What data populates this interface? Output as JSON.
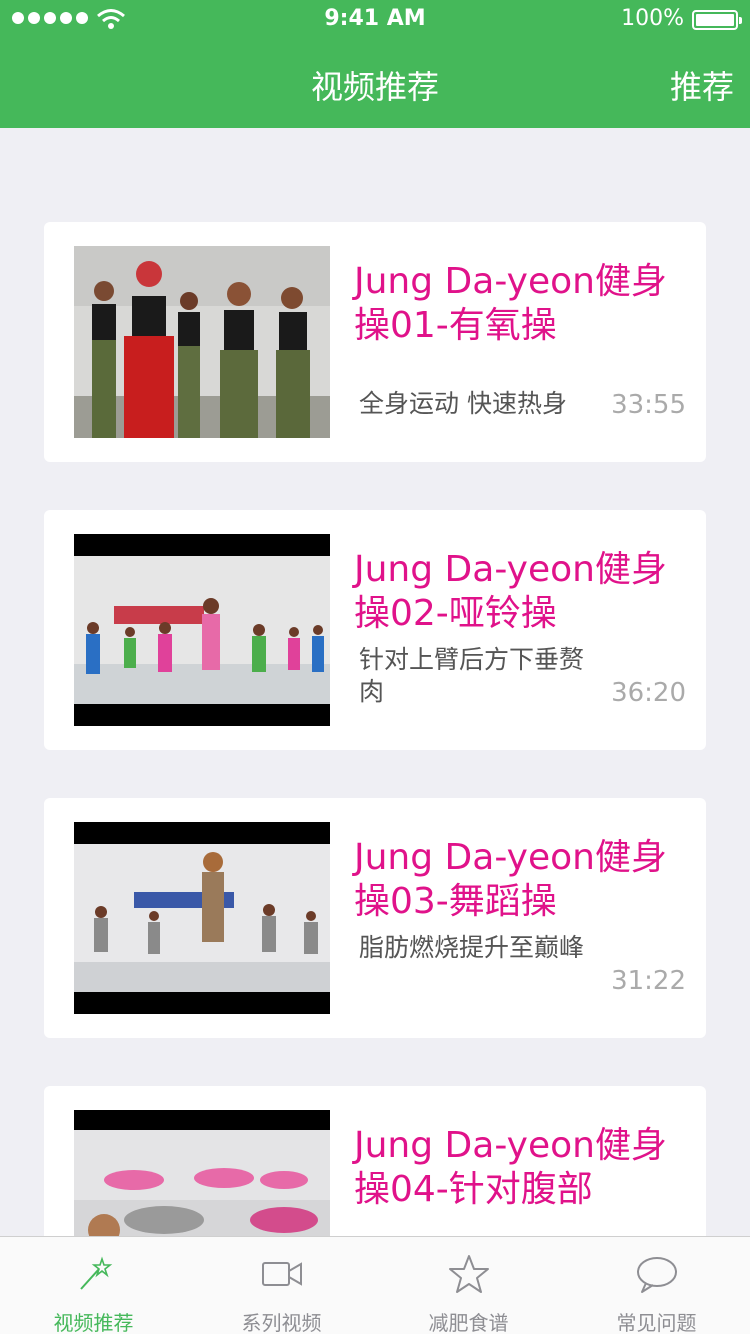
{
  "status_bar": {
    "time": "9:41 AM",
    "battery": "100%"
  },
  "nav": {
    "title": "视频推荐",
    "right_action": "推荐"
  },
  "videos": [
    {
      "title": "Jung Da-yeon健身操01-有氧操",
      "description": "全身运动 快速热身",
      "duration": "33:55"
    },
    {
      "title": "Jung Da-yeon健身操02-哑铃操",
      "description": "针对上臂后方下垂赘肉",
      "duration": "36:20"
    },
    {
      "title": "Jung Da-yeon健身操03-舞蹈操",
      "description": "脂肪燃烧提升至巅峰",
      "duration": "31:22"
    },
    {
      "title": "Jung Da-yeon健身操04-针对腹部",
      "description": "",
      "duration": ""
    }
  ],
  "tabs": [
    {
      "label": "视频推荐",
      "icon": "magic-wand-icon",
      "active": true
    },
    {
      "label": "系列视频",
      "icon": "video-camera-icon",
      "active": false
    },
    {
      "label": "减肥食谱",
      "icon": "star-icon",
      "active": false
    },
    {
      "label": "常见问题",
      "icon": "chat-bubble-icon",
      "active": false
    }
  ],
  "colors": {
    "accent": "#45b85a",
    "title": "#e0128a",
    "background": "#efeff4"
  }
}
